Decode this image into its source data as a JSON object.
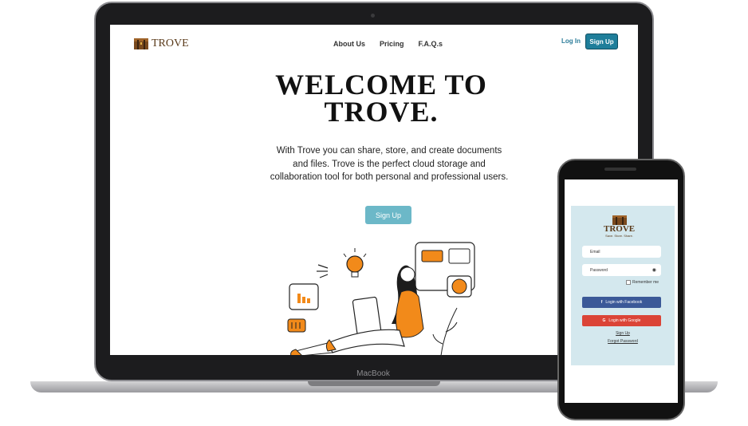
{
  "laptop": {
    "brand": "MacBook"
  },
  "site": {
    "logo_text": "TROVE",
    "nav": [
      "About Us",
      "Pricing",
      "F.A.Q.s"
    ],
    "login": "Log In",
    "signup_top": "Sign Up",
    "title_line1": "WELCOME TO",
    "title_line2": "TROVE.",
    "description": "With Trove you can share, store, and create documents and files. Trove is the perfect cloud storage and collaboration tool for both personal and professional users.",
    "signup_main": "Sign Up"
  },
  "phone": {
    "logo_text": "TROVE",
    "tagline": "Save. Store. Share.",
    "email_placeholder": "Email",
    "password_placeholder": "Password",
    "remember": "Remember me",
    "facebook": "Login with Facebook",
    "google": "Login with Google",
    "signup_link": "Sign Up",
    "forgot_link": "Forgot Password"
  },
  "colors": {
    "accent": "#1f7e9a",
    "button_light": "#6cb8c8",
    "illustration_orange": "#f28a1a",
    "facebook": "#3b5998",
    "google": "#db4437",
    "phone_card": "#d4e8ee"
  }
}
